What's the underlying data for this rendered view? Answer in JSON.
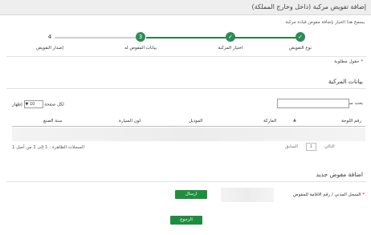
{
  "title": "إضافة تفويض مركبة (داخل وخارج المملكة)",
  "note": "يسمح هذا الخيار بإضافة مفوض قيادة مركبة",
  "steps": [
    {
      "label": "نوع التفويض",
      "status": "done"
    },
    {
      "label": "اختيار المركبة",
      "status": "done"
    },
    {
      "label": "بيانات المفوض له",
      "number": "3",
      "status": "current"
    },
    {
      "label": "إصدار التفويض",
      "number": "4",
      "status": "pending"
    }
  ],
  "required_note": "* حقول مطلوبة",
  "vehicle_section_title": "بيانات المركبة",
  "search_label": "بحث سريع :",
  "show_label": "إظهار",
  "page_size": "10",
  "per_page_label": "لكل صفحة",
  "table_headers": [
    "رقم اللوحة",
    "الماركة",
    "الموديل",
    "لون السيارة",
    "سنة الصنع"
  ],
  "pagination": {
    "previous": "السابق",
    "page": "1",
    "next": "التالي"
  },
  "records_info": "السجلات الظاهرة : 1 إلى 1 من أصل 1",
  "new_delegate_title": "اضافة مفوض جديد",
  "id_label": "السجل المدني / رقم الاقامة للمفوض",
  "send_button": "ارسال",
  "back_button": "الرجوع",
  "colors": {
    "accent": "#2e8b57",
    "button": "#1e8e3e"
  }
}
